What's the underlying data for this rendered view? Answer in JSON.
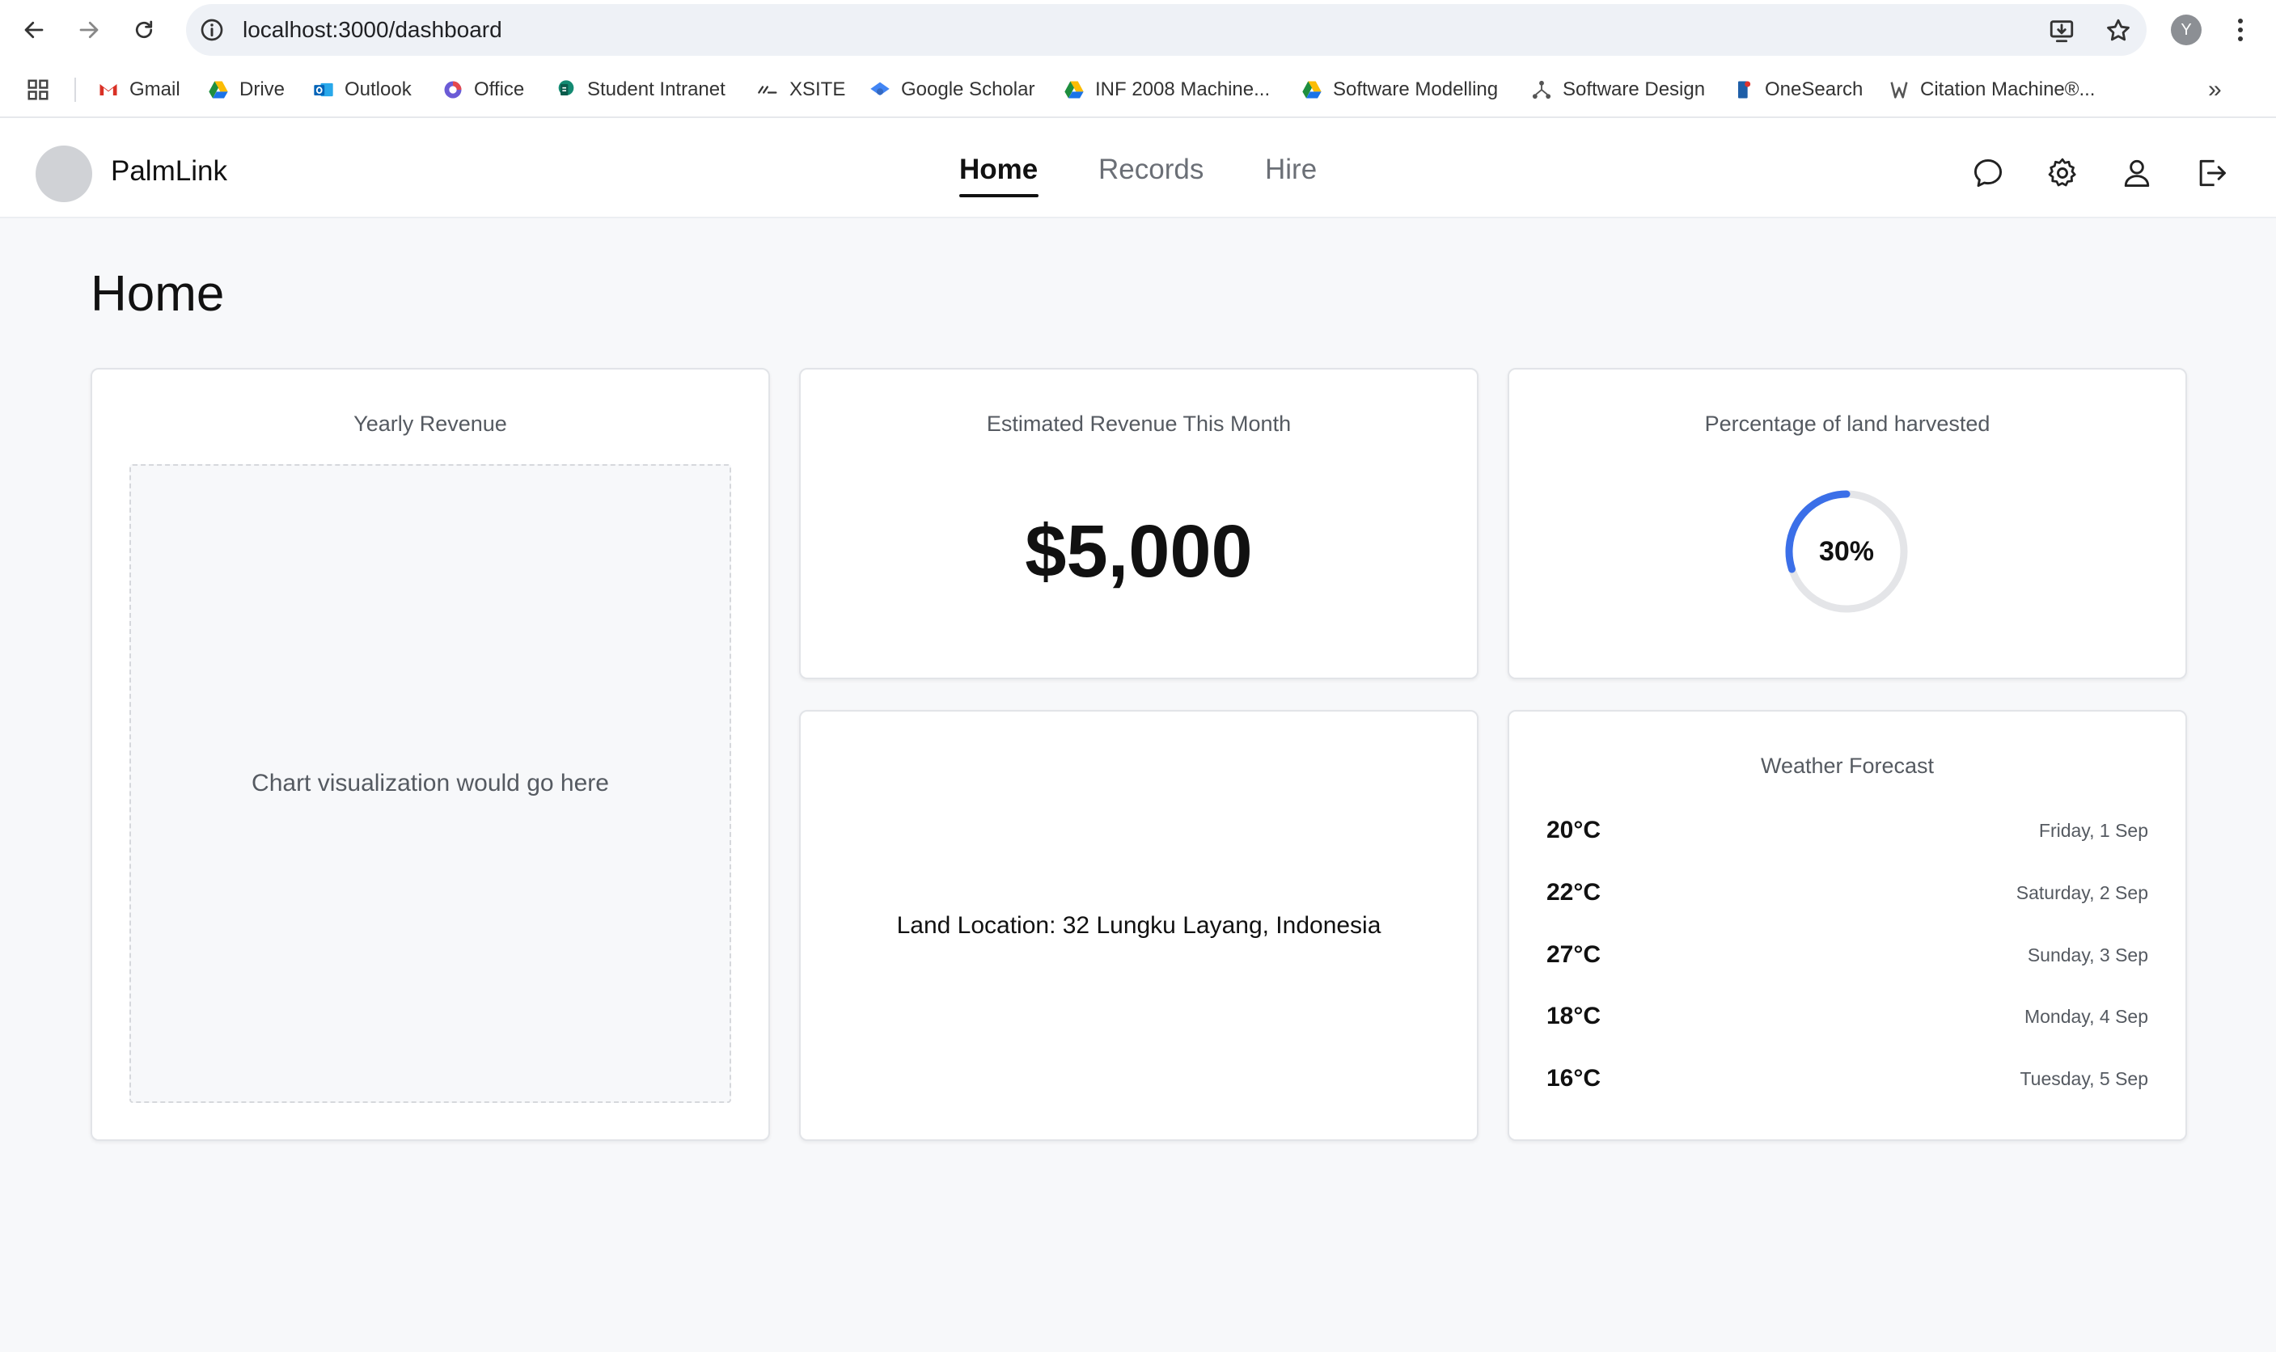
{
  "browser": {
    "url": "localhost:3000/dashboard",
    "profile_initial": "Y",
    "bookmarks": [
      {
        "label": "Gmail",
        "icon": "gmail-icon"
      },
      {
        "label": "Drive",
        "icon": "drive-icon"
      },
      {
        "label": "Outlook",
        "icon": "outlook-icon"
      },
      {
        "label": "Office",
        "icon": "office-icon"
      },
      {
        "label": "Student Intranet",
        "icon": "intranet-icon"
      },
      {
        "label": "XSITE",
        "icon": "xsite-icon"
      },
      {
        "label": "Google Scholar",
        "icon": "scholar-icon"
      },
      {
        "label": "INF 2008 Machine...",
        "icon": "drive-icon"
      },
      {
        "label": "Software Modelling",
        "icon": "drive-icon"
      },
      {
        "label": "Software Design",
        "icon": "design-icon"
      },
      {
        "label": "OneSearch",
        "icon": "onesearch-icon"
      },
      {
        "label": "Citation Machine®...",
        "icon": "citation-icon"
      }
    ],
    "overflow": "»"
  },
  "app": {
    "brand": "PalmLink",
    "tabs": [
      {
        "label": "Home",
        "active": true
      },
      {
        "label": "Records",
        "active": false
      },
      {
        "label": "Hire",
        "active": false
      }
    ],
    "header_icons": [
      "chat-icon",
      "gear-icon",
      "user-icon",
      "logout-icon"
    ]
  },
  "page": {
    "title": "Home",
    "yearly_revenue": {
      "title": "Yearly Revenue",
      "placeholder": "Chart visualization would go here"
    },
    "estimated_revenue": {
      "title": "Estimated Revenue This Month",
      "value": "$5,000"
    },
    "land_harvested": {
      "title": "Percentage of land harvested",
      "label": "30%",
      "fraction": 0.3
    },
    "land_location": {
      "text": "Land Location: 32 Lungku Layang, Indonesia"
    },
    "weather": {
      "title": "Weather Forecast",
      "days": [
        {
          "temp": "20°C",
          "date": "Friday, 1 Sep"
        },
        {
          "temp": "22°C",
          "date": "Saturday, 2 Sep"
        },
        {
          "temp": "27°C",
          "date": "Sunday, 3 Sep"
        },
        {
          "temp": "18°C",
          "date": "Monday, 4 Sep"
        },
        {
          "temp": "16°C",
          "date": "Tuesday, 5 Sep"
        }
      ]
    }
  },
  "colors": {
    "accent": "#3b6fe8",
    "ring_track": "#e4e5e8",
    "page_bg": "#f7f8fa"
  }
}
